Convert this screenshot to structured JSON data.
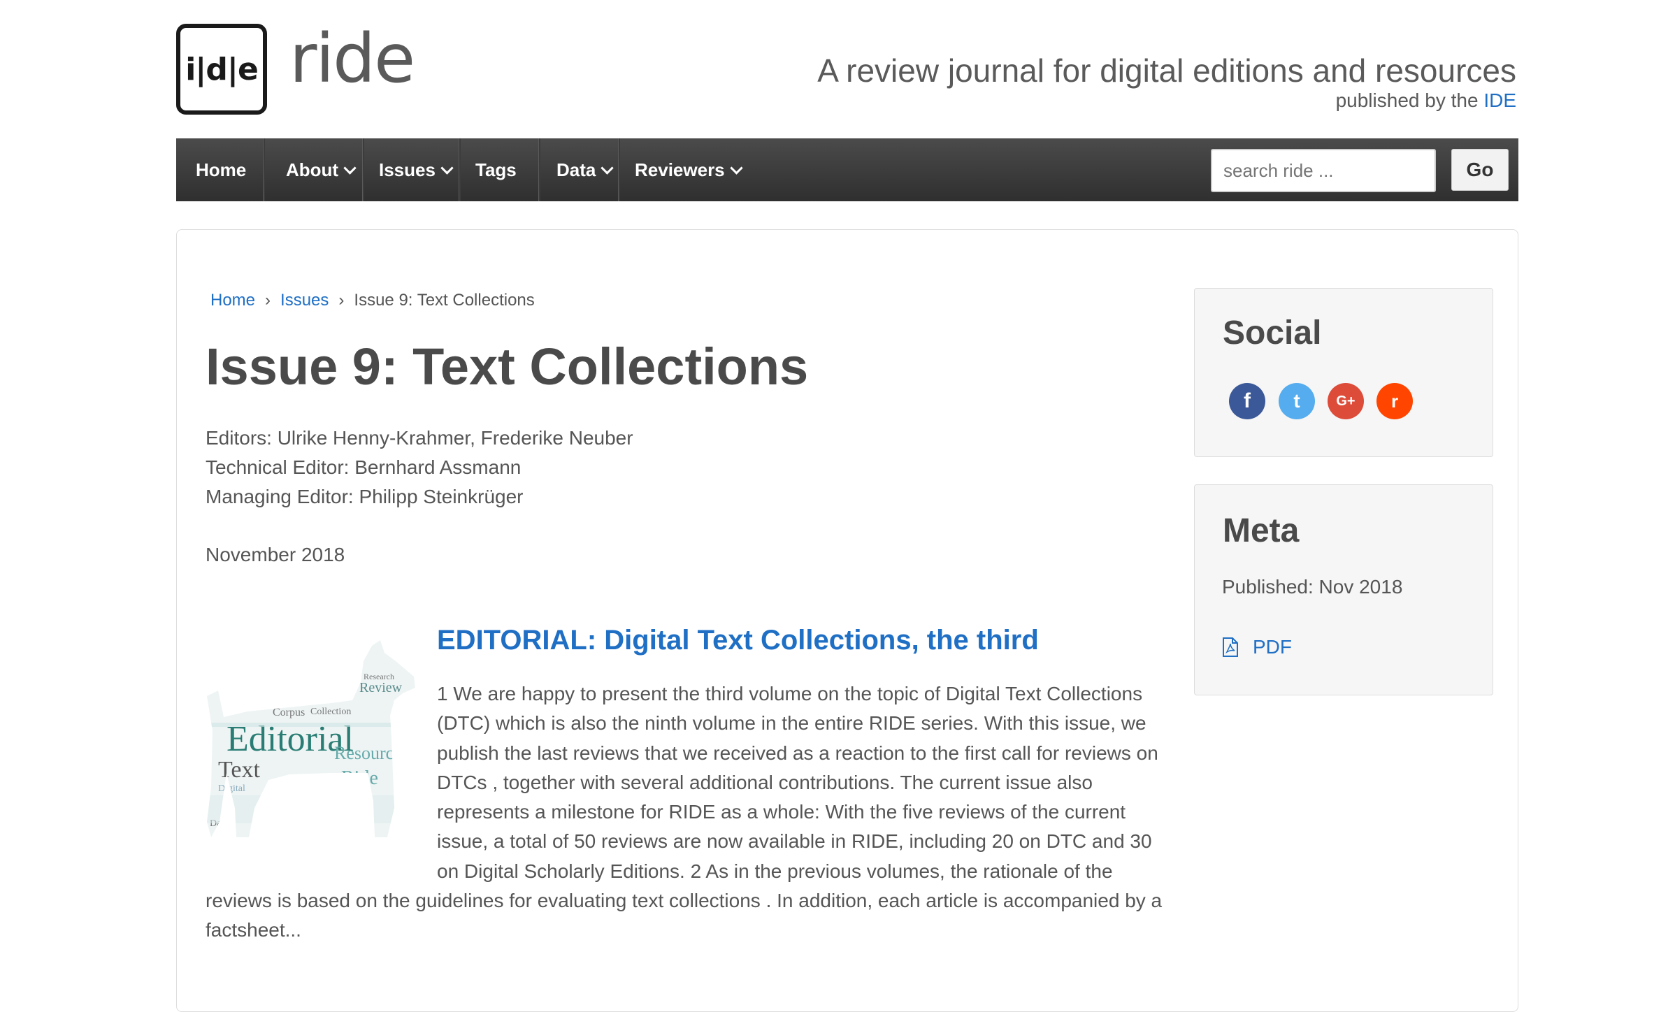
{
  "header": {
    "logo_mark": "i|d|e",
    "logo_word": "ride",
    "tagline": "A review journal for digital editions and resources",
    "publisher_prefix": "published by the",
    "publisher_link": "IDE"
  },
  "nav": {
    "items": [
      {
        "label": "Home",
        "dropdown": false
      },
      {
        "label": "About",
        "dropdown": true
      },
      {
        "label": "Issues",
        "dropdown": true
      },
      {
        "label": "Tags",
        "dropdown": false
      },
      {
        "label": "Data",
        "dropdown": true
      },
      {
        "label": "Reviewers",
        "dropdown": true
      }
    ],
    "search_placeholder": "search ride ...",
    "search_button": "Go"
  },
  "breadcrumb": {
    "items": [
      "Home",
      "Issues"
    ],
    "current": "Issue 9: Text Collections"
  },
  "page": {
    "title": "Issue 9: Text Collections",
    "editors": [
      "Editors: Ulrike Henny-Krahmer, Frederike Neuber",
      "Technical Editor: Bernhard Assmann",
      "Managing Editor: Philipp Steinkrüger"
    ],
    "date": "November 2018"
  },
  "article": {
    "title": "EDITORIAL: Digital Text Collections, the third",
    "image_words": {
      "main": "Editorial",
      "second": "Text",
      "third": "Review",
      "fourth": "Resource",
      "fifth": "Ride",
      "sixth": "Corpus",
      "seventh": "Collection",
      "eighth": "Research",
      "ninth": "Digital",
      "tenth": "Data"
    },
    "excerpt": "1 We are happy to present the third volume on the topic of Digital Text Collections (DTC) which is also the ninth volume in the entire RIDE series. With this issue, we publish the last reviews that we received as a reaction to the first call for reviews on DTCs , together with several additional contributions. The current issue also represents a milestone for RIDE as a whole: With the five reviews of the current issue, a total of 50 reviews are now available in RIDE, including 20 on DTC and 30 on Digital Scholarly Editions. 2 As in the previous volumes, the rationale of the reviews is based on the guidelines for evaluating text collections . In addition, each article is accompanied by a factsheet..."
  },
  "sidebar": {
    "social_title": "Social",
    "social_icons": [
      {
        "name": "facebook-icon",
        "glyph": "f",
        "color": "#3b5998"
      },
      {
        "name": "twitter-icon",
        "glyph": "t",
        "color": "#55acee"
      },
      {
        "name": "google-plus-icon",
        "glyph": "G+",
        "color": "#dd4b39"
      },
      {
        "name": "reddit-icon",
        "glyph": "r",
        "color": "#ff4500"
      }
    ],
    "meta_title": "Meta",
    "published": "Published: Nov 2018",
    "pdf_label": "PDF"
  }
}
